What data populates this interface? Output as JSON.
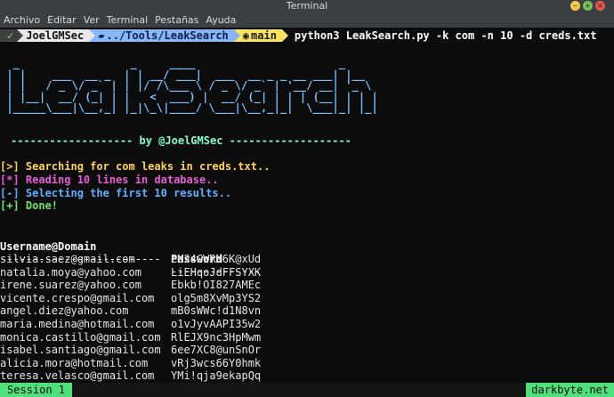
{
  "window": {
    "title": "Terminal"
  },
  "menu": {
    "items": [
      "Archivo",
      "Editar",
      "Ver",
      "Terminal",
      "Pestañas",
      "Ayuda"
    ]
  },
  "prompt": {
    "check": "✓",
    "user": "JoelGMSec",
    "path": "../Tools/LeakSearch",
    "branch": "main",
    "command": "python3 LeakSearch.py -k com -n 10 -d creds.txt"
  },
  "banner": {
    "art": "  _                 _     ____                      _     \n | |    ___  __ _  | | __/ ___|  ___  __ _ _ __ ___| |__  \n | |   / _ \\/ _` | | |/ /\\___ \\ / _ \\/ _` | '__/ __| '_ \\ \n | |__|  __/ (_| | |   <  ___) |  __/ (_| | | | (__| | | |\n |_____\\___|\\__,_| |_|\\_\\|____/ \\___|\\__,_|_|  \\___|_| |_|",
    "byline": "------------------- by @JoelGMSec -------------------"
  },
  "status_lines": [
    {
      "text": "[>] Searching for com leaks in creds.txt..",
      "color": "#ffd44a"
    },
    {
      "text": "[*] Reading 10 lines in database..",
      "color": "#e85cd6"
    },
    {
      "text": "[-] Selecting the first 10 results..",
      "color": "#5bb1ff"
    },
    {
      "text": "[+] Done!",
      "color": "#6fe66a"
    }
  ],
  "table": {
    "headers": [
      "Username@Domain",
      "Password"
    ],
    "separators": [
      "-------------------------",
      "--------------"
    ],
    "rows": [
      [
        "silvia.saez@gmail.com",
        "eM24CWRM6K@xUd"
      ],
      [
        "natalia.moya@yahoo.com",
        "LiEHqoJdFFSYXK"
      ],
      [
        "irene.suarez@yahoo.com",
        "Ebkb!OI827AMEc"
      ],
      [
        "vicente.crespo@gmail.com",
        "olg5m8XvMp3YS2"
      ],
      [
        "angel.diez@yahoo.com",
        "mB0sWWc!d1N8vn"
      ],
      [
        "maria.medina@hotmail.com",
        "o1vJyvAAPI35w2"
      ],
      [
        "monica.castillo@gmail.com",
        "RlEJX9nc3HpMwm"
      ],
      [
        "isabel.santiago@gmail.com",
        "6ee7XC8@unSnOr"
      ],
      [
        "alicia.mora@hotmail.com",
        "vRj3wcs66Y0hmk"
      ],
      [
        "teresa.velasco@gmail.com",
        "YMi!qja9ekapQq"
      ]
    ]
  },
  "statusbar": {
    "session": "Session 1",
    "host": "darkbyte.net"
  },
  "colors": {
    "terminal_bg": "#0c0c0c",
    "banner": "#78c0ff",
    "byline": "#7fffd4",
    "statusbar_tab": "#4ee07a"
  }
}
